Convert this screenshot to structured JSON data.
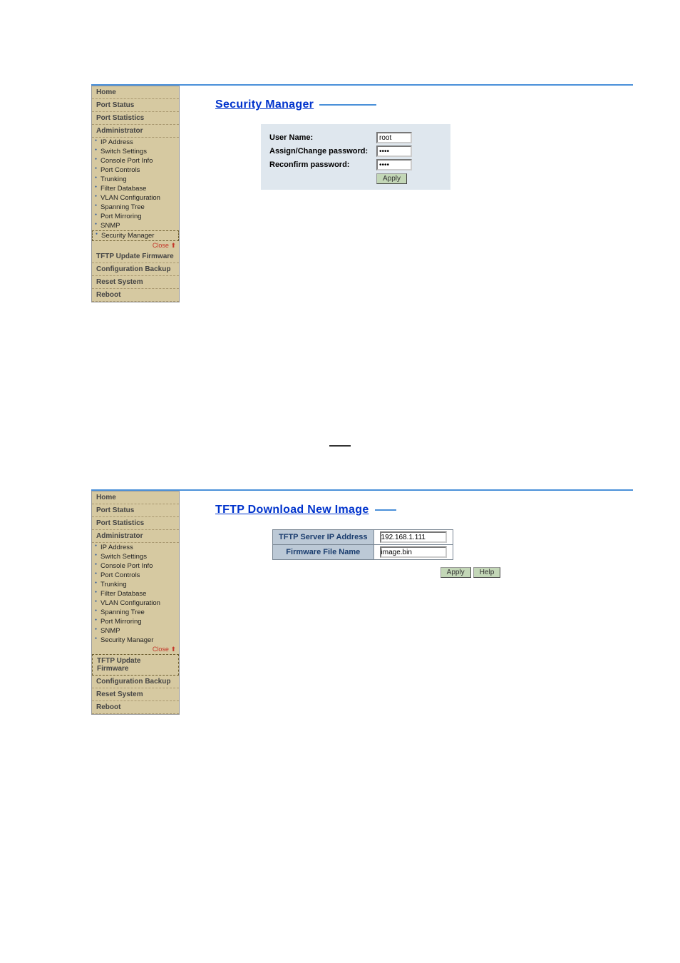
{
  "nav": {
    "home": "Home",
    "port_status": "Port Status",
    "port_statistics": "Port Statistics",
    "administrator": "Administrator",
    "sub": {
      "ip": "IP Address",
      "switch": "Switch Settings",
      "console": "Console Port Info",
      "port_controls": "Port Controls",
      "trunking": "Trunking",
      "filter": "Filter Database",
      "vlan": "VLAN Configuration",
      "spanning": "Spanning Tree",
      "mirror": "Port Mirroring",
      "snmp": "SNMP",
      "secmgr": "Security Manager"
    },
    "close": "Close",
    "tftp": "TFTP Update Firmware",
    "cfg_backup": "Configuration Backup",
    "reset": "Reset System",
    "reboot": "Reboot"
  },
  "top": {
    "title": "Security Manager",
    "username_label": "User Name:",
    "username_value": "root",
    "assign_label": "Assign/Change password:",
    "assign_value": "****",
    "reconfirm_label": "Reconfirm password:",
    "reconfirm_value": "****",
    "apply": "Apply"
  },
  "bottom": {
    "title": "TFTP Download New Image",
    "server_label": "TFTP Server IP Address",
    "server_value": "192.168.1.111",
    "file_label": "Firmware File Name",
    "file_value": "image.bin",
    "apply": "Apply",
    "help": "Help"
  },
  "close_icon": "⬆"
}
